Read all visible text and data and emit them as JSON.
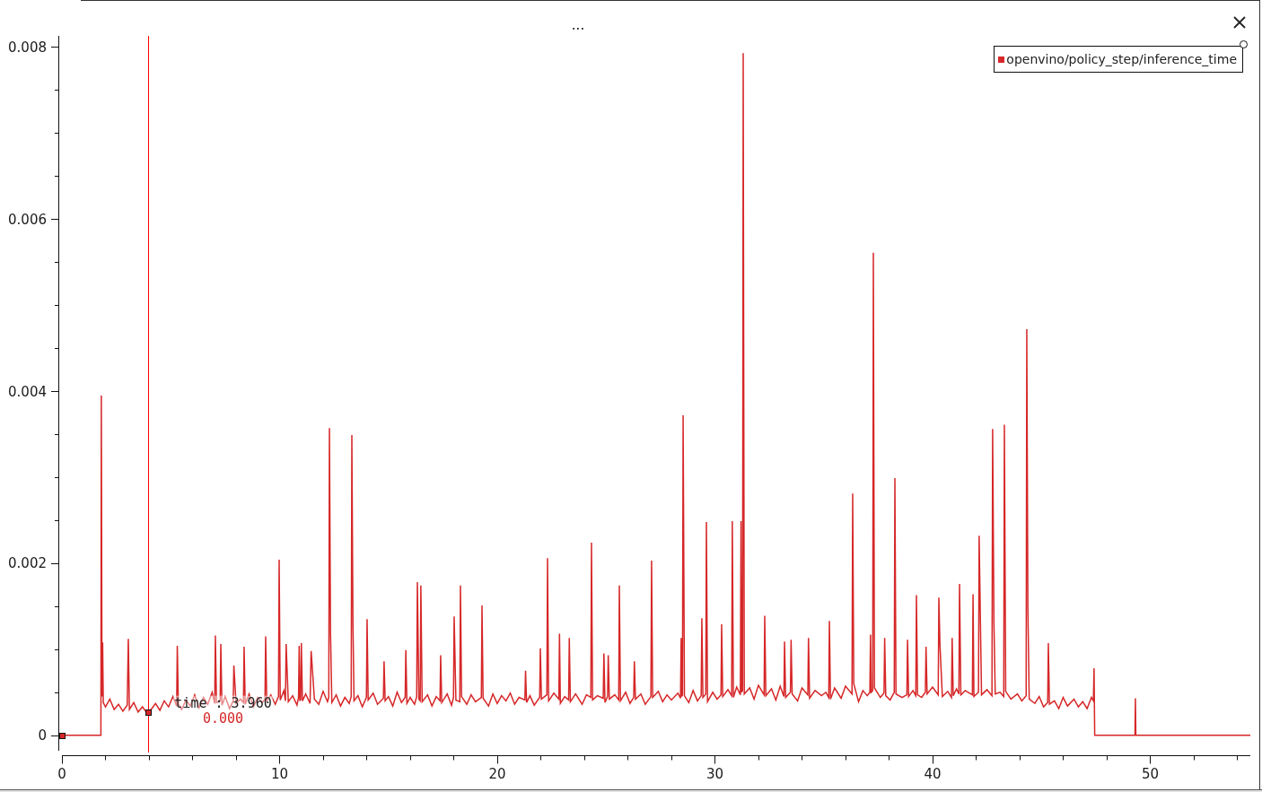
{
  "plot": {
    "chart_data": {
      "type": "line",
      "title": "...",
      "x": [
        0,
        1.79,
        1.81,
        1.84,
        1.87,
        1.9,
        2.0,
        2.2,
        2.4,
        2.6,
        2.8,
        3.0,
        3.05,
        3.1,
        3.3,
        3.5,
        3.7,
        3.9,
        4.1,
        4.3,
        4.5,
        4.7,
        4.9,
        5.1,
        5.27,
        5.3,
        5.35,
        5.5,
        5.7,
        5.9,
        6.1,
        6.3,
        6.5,
        6.7,
        6.9,
        7.02,
        7.05,
        7.1,
        7.27,
        7.3,
        7.35,
        7.5,
        7.7,
        7.87,
        7.9,
        8.0,
        8.2,
        8.34,
        8.37,
        8.42,
        8.6,
        8.8,
        9.0,
        9.2,
        9.33,
        9.36,
        9.41,
        9.6,
        9.8,
        9.95,
        9.98,
        10.03,
        10.2,
        10.27,
        10.3,
        10.4,
        10.6,
        10.8,
        10.87,
        10.9,
        10.93,
        10.97,
        11.0,
        11.05,
        11.2,
        11.4,
        11.45,
        11.6,
        11.8,
        12.0,
        12.2,
        12.26,
        12.29,
        12.34,
        12.4,
        12.6,
        12.8,
        13.0,
        13.2,
        13.29,
        13.32,
        13.37,
        13.42,
        13.6,
        13.8,
        13.99,
        14.02,
        14.07,
        14.3,
        14.5,
        14.77,
        14.8,
        14.85,
        15.0,
        15.2,
        15.4,
        15.6,
        15.77,
        15.8,
        15.85,
        16.0,
        16.2,
        16.3,
        16.33,
        16.4,
        16.46,
        16.49,
        16.55,
        16.8,
        17.0,
        17.2,
        17.37,
        17.4,
        17.45,
        17.7,
        17.9,
        17.99,
        18.02,
        18.1,
        18.28,
        18.31,
        18.36,
        18.6,
        18.8,
        19.0,
        19.27,
        19.3,
        19.35,
        19.6,
        19.8,
        20.0,
        20.2,
        20.4,
        20.6,
        20.8,
        21.0,
        21.27,
        21.3,
        21.35,
        21.5,
        21.7,
        21.95,
        21.98,
        22.03,
        22.28,
        22.31,
        22.36,
        22.6,
        22.83,
        22.86,
        22.9,
        23.1,
        23.28,
        23.31,
        23.36,
        23.6,
        23.9,
        24.1,
        24.3,
        24.33,
        24.38,
        24.6,
        24.87,
        24.9,
        24.95,
        25.07,
        25.1,
        25.15,
        25.4,
        25.58,
        25.61,
        25.66,
        25.9,
        26.1,
        26.27,
        26.3,
        26.35,
        26.6,
        26.8,
        27.06,
        27.09,
        27.14,
        27.4,
        27.6,
        27.8,
        28.0,
        28.3,
        28.42,
        28.45,
        28.48,
        28.51,
        28.54,
        28.6,
        28.8,
        29.0,
        29.2,
        29.37,
        29.4,
        29.45,
        29.58,
        29.61,
        29.66,
        29.9,
        30.1,
        30.28,
        30.31,
        30.36,
        30.6,
        30.77,
        30.8,
        30.85,
        31.0,
        31.17,
        31.2,
        31.23,
        31.27,
        31.3,
        31.35,
        31.6,
        31.8,
        32.0,
        32.26,
        32.29,
        32.34,
        32.6,
        32.8,
        33.0,
        33.17,
        33.2,
        33.25,
        33.47,
        33.5,
        33.55,
        33.8,
        34.0,
        34.27,
        34.3,
        34.35,
        34.6,
        34.9,
        35.1,
        35.23,
        35.26,
        35.31,
        35.5,
        35.8,
        36.0,
        36.3,
        36.33,
        36.38,
        36.6,
        36.8,
        37.0,
        37.12,
        37.15,
        37.18,
        37.25,
        37.28,
        37.33,
        37.6,
        37.77,
        37.8,
        37.85,
        38.05,
        38.24,
        38.27,
        38.32,
        38.6,
        38.82,
        38.85,
        38.9,
        39.1,
        39.23,
        39.26,
        39.31,
        39.5,
        39.67,
        39.7,
        39.75,
        40.0,
        40.26,
        40.29,
        40.34,
        40.45,
        40.7,
        40.87,
        40.9,
        40.95,
        41.1,
        41.21,
        41.24,
        41.3,
        41.5,
        41.83,
        41.86,
        41.9,
        42.11,
        42.14,
        42.2,
        42.25,
        42.5,
        42.73,
        42.76,
        42.82,
        42.88,
        43.1,
        43.27,
        43.3,
        43.36,
        43.6,
        43.9,
        44.1,
        44.3,
        44.33,
        44.38,
        44.44,
        44.7,
        44.9,
        45.1,
        45.29,
        45.32,
        45.37,
        45.6,
        45.8,
        46.0,
        46.2,
        46.5,
        46.7,
        46.9,
        47.1,
        47.3,
        47.39,
        47.42,
        47.45,
        49.3,
        49.32,
        49.34,
        54.6
      ],
      "series": [
        {
          "name": "openvino/policy_step/inference_time",
          "color": "#d62728",
          "values": [
            0,
            0,
            0.00395,
            0.00045,
            0.00108,
            0.00038,
            0.00033,
            0.00042,
            0.0003,
            0.00036,
            0.00028,
            0.00035,
            0.00112,
            0.0003,
            0.00038,
            0.00027,
            0.00033,
            0.00026,
            0.0003,
            0.00037,
            0.00029,
            0.0004,
            0.00033,
            0.00045,
            0.00034,
            0.00104,
            0.00036,
            0.0003,
            0.00041,
            0.00034,
            0.00047,
            0.00032,
            0.00044,
            0.00036,
            0.0005,
            0.00037,
            0.00116,
            0.00038,
            0.0004,
            0.00106,
            0.00035,
            0.00045,
            0.00031,
            0.0004,
            0.00081,
            0.00037,
            0.00042,
            0.00038,
            0.00103,
            0.00036,
            0.00048,
            0.00033,
            0.00044,
            0.00038,
            0.00042,
            0.00115,
            0.0004,
            0.00047,
            0.00036,
            0.00045,
            0.00204,
            0.00041,
            0.00052,
            0.0004,
            0.00106,
            0.00039,
            0.00046,
            0.00035,
            0.00044,
            0.00104,
            0.0004,
            0.00042,
            0.00107,
            0.0004,
            0.00048,
            0.00037,
            0.00098,
            0.00042,
            0.00036,
            0.00051,
            0.00039,
            0.00044,
            0.00357,
            0.0012,
            0.00038,
            0.00047,
            0.00034,
            0.00044,
            0.00037,
            0.00045,
            0.00349,
            0.0013,
            0.0004,
            0.00046,
            0.00033,
            0.00044,
            0.00135,
            0.00041,
            0.00049,
            0.00036,
            0.00043,
            0.00086,
            0.0004,
            0.00045,
            0.00034,
            0.0005,
            0.00038,
            0.00044,
            0.00099,
            0.00037,
            0.00044,
            0.00036,
            0.00045,
            0.00178,
            0.00042,
            0.0004,
            0.00174,
            0.00039,
            0.00047,
            0.00034,
            0.00045,
            0.0004,
            0.00093,
            0.00038,
            0.00048,
            0.00035,
            0.00044,
            0.00138,
            0.00041,
            0.00039,
            0.00174,
            0.00045,
            0.00036,
            0.00047,
            0.00039,
            0.00044,
            0.00151,
            0.00043,
            0.00034,
            0.00048,
            0.00037,
            0.00046,
            0.0004,
            0.00049,
            0.00036,
            0.00044,
            0.00041,
            0.00075,
            0.00038,
            0.00046,
            0.00035,
            0.00044,
            0.00101,
            0.00042,
            0.00047,
            0.00206,
            0.0004,
            0.00049,
            0.00042,
            0.00118,
            0.00037,
            0.00045,
            0.00041,
            0.00113,
            0.00039,
            0.00048,
            0.00036,
            0.00047,
            0.00044,
            0.00224,
            0.00041,
            0.00046,
            0.00043,
            0.00095,
            0.00038,
            0.00045,
            0.00093,
            0.00042,
            0.00047,
            0.00041,
            0.00174,
            0.0004,
            0.0005,
            0.00037,
            0.00044,
            0.00086,
            0.00042,
            0.00048,
            0.00036,
            0.00045,
            0.00203,
            0.00044,
            0.00051,
            0.00039,
            0.00047,
            0.00041,
            0.00049,
            0.00043,
            0.00113,
            0.00045,
            0.00047,
            0.00372,
            0.00046,
            0.00038,
            0.00052,
            0.0004,
            0.00046,
            0.00136,
            0.00044,
            0.00048,
            0.00248,
            0.00039,
            0.0005,
            0.00042,
            0.00047,
            0.00129,
            0.00045,
            0.00053,
            0.00046,
            0.00249,
            0.00044,
            0.00056,
            0.00047,
            0.00249,
            0.0005,
            0.00052,
            0.00793,
            0.00048,
            0.00055,
            0.00042,
            0.00058,
            0.00047,
            0.00139,
            0.00046,
            0.00054,
            0.00041,
            0.00057,
            0.00045,
            0.00109,
            0.00044,
            0.0005,
            0.00111,
            0.00048,
            0.0004,
            0.00055,
            0.00047,
            0.00113,
            0.00043,
            0.00052,
            0.00046,
            0.0005,
            0.00044,
            0.00133,
            0.00042,
            0.00055,
            0.00043,
            0.00057,
            0.00048,
            0.00281,
            0.0006,
            0.00039,
            0.00052,
            0.00046,
            0.0005,
            0.00117,
            0.0005,
            0.00052,
            0.00561,
            0.00055,
            0.00044,
            0.00049,
            0.00113,
            0.00046,
            0.00041,
            0.0005,
            0.00299,
            0.00048,
            0.00044,
            0.00047,
            0.00111,
            0.00045,
            0.00052,
            0.00046,
            0.00163,
            0.00047,
            0.00044,
            0.0005,
            0.00103,
            0.00048,
            0.00056,
            0.00047,
            0.0016,
            0.00105,
            0.00045,
            0.00051,
            0.00044,
            0.00113,
            0.00046,
            0.00054,
            0.00048,
            0.00176,
            0.00047,
            0.00052,
            0.00047,
            0.00164,
            0.00045,
            0.0005,
            0.00232,
            0.00131,
            0.00047,
            0.00053,
            0.00046,
            0.00356,
            0.0013,
            0.00048,
            0.0005,
            0.00045,
            0.00361,
            0.00051,
            0.00042,
            0.00048,
            0.0004,
            0.00046,
            0.00472,
            0.00148,
            0.00042,
            0.00037,
            0.00045,
            0.00033,
            0.00038,
            0.00107,
            0.00036,
            0.0004,
            0.00031,
            0.00044,
            0.00034,
            0.00042,
            0.00033,
            0.00039,
            0.00031,
            0.00044,
            0.0004,
            0.00078,
            0,
            0,
            0.00043,
            0,
            0
          ]
        }
      ],
      "xlim": [
        0,
        54.6
      ],
      "ylim": [
        -0.00018,
        0.00813
      ],
      "xticks": [
        0,
        10,
        20,
        30,
        40,
        50
      ],
      "yticks": [
        0,
        0.002,
        0.004,
        0.006,
        0.008
      ],
      "ref_lines": [
        {
          "axis": "x",
          "value": 3.96,
          "color": "#ff0000"
        }
      ],
      "annotations": [
        {
          "text": "time : 3.960"
        },
        {
          "text": "0.000"
        }
      ]
    }
  }
}
